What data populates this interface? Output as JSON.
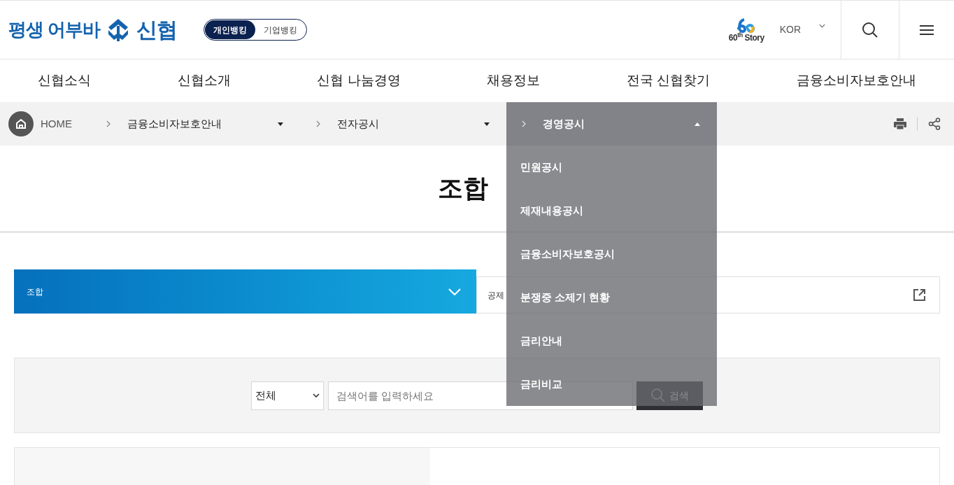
{
  "header": {
    "logo": {
      "slogan": "평생 어부바",
      "brand": "신협"
    },
    "banking_toggle": [
      {
        "label": "개인뱅킹",
        "selected": true
      },
      {
        "label": "기업뱅킹",
        "selected": false
      }
    ],
    "anniversary_logo": {
      "caption": "60$^{th}$ Story"
    },
    "language": "KOR"
  },
  "nav": [
    "신협소식",
    "신협소개",
    "신협 나눔경영",
    "채용정보",
    "전국 신협찾기",
    "금융소비자보호안내"
  ],
  "breadcrumb": {
    "home": "HOME",
    "items": [
      {
        "label": "금융소비자보호안내",
        "expanded": false
      },
      {
        "label": "전자공시",
        "expanded": false
      },
      {
        "label": "경영공시",
        "expanded": true
      }
    ]
  },
  "dropdown": [
    "민원공시",
    "제재내용공시",
    "금융소비자보호공시",
    "분쟁중 소제기 현황",
    "금리안내",
    "금리비교"
  ],
  "page_title": "조합",
  "tabs": [
    {
      "label": "조합",
      "selected": true
    },
    {
      "label": "공제",
      "selected": false
    }
  ],
  "search": {
    "scope": "전체",
    "placeholder": "검색어를 입력하세요",
    "button": "검색"
  }
}
